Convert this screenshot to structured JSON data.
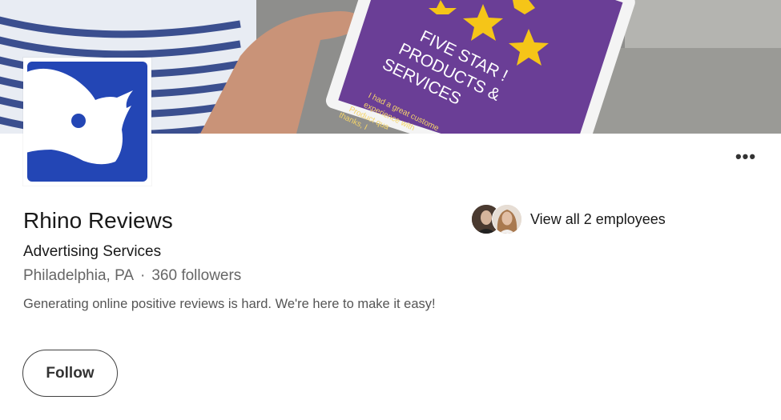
{
  "company": {
    "name": "Rhino Reviews",
    "industry": "Advertising Services",
    "location": "Philadelphia, PA",
    "separator": "·",
    "followers": "360 followers",
    "tagline": "Generating online positive reviews is hard. We're here to make it easy!"
  },
  "actions": {
    "follow_label": "Follow",
    "more_label": "•••"
  },
  "employees": {
    "link_label": "View all 2 employees"
  },
  "cover": {
    "tablet_heading_lines": [
      "FIVE STAR !",
      "PRODUCTS &",
      "SERVICES"
    ],
    "tablet_body_lines": [
      "I had a great custome",
      "experience with",
      "Product qua",
      "thanks, I"
    ]
  },
  "colors": {
    "brand_blue": "#2346b5",
    "tablet_purple": "#6a3e96",
    "star_yellow": "#f5c518"
  },
  "icons": {
    "logo": "rhino-logo-icon",
    "more": "more-options-icon"
  }
}
